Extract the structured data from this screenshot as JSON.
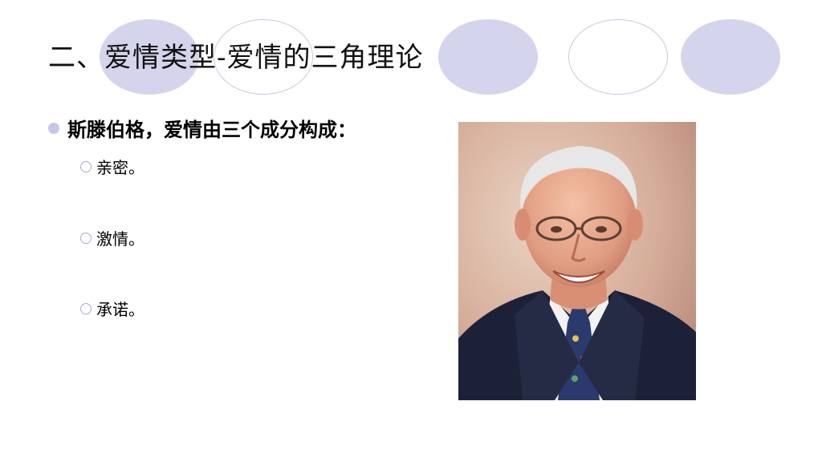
{
  "slide": {
    "title": "二、爱情类型-爱情的三角理论",
    "bullet": "斯滕伯格，爱情由三个成分构成：",
    "items": [
      {
        "label": "亲密。"
      },
      {
        "label": "激情。"
      },
      {
        "label": "承诺。"
      }
    ],
    "photo_subject": "person-photo"
  },
  "colors": {
    "accent_circle": "#d4d4ec",
    "bullet_dot": "#c6c6ea"
  }
}
